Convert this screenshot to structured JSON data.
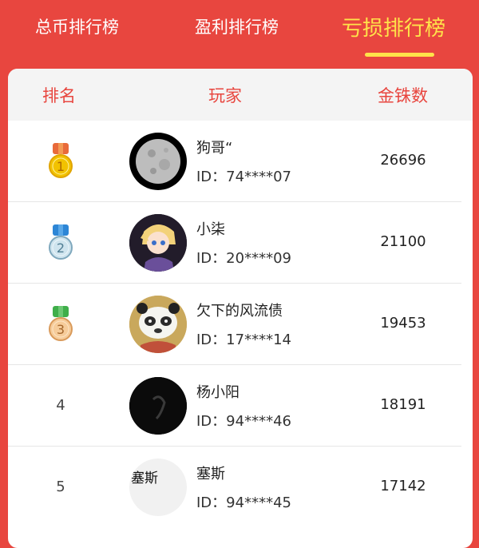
{
  "tabs": [
    {
      "label": "总币排行榜"
    },
    {
      "label": "盈利排行榜"
    },
    {
      "label": "亏损排行榜"
    }
  ],
  "table": {
    "headers": {
      "rank": "排名",
      "player": "玩家",
      "coins": "金铢数"
    },
    "rows": [
      {
        "rank": "1",
        "name": "狗哥“",
        "id": "ID：74****07",
        "coins": "26696"
      },
      {
        "rank": "2",
        "name": "小柒",
        "id": "ID：20****09",
        "coins": "21100"
      },
      {
        "rank": "3",
        "name": "欠下的风流债",
        "id": "ID：17****14",
        "coins": "19453"
      },
      {
        "rank": "4",
        "name": "杨小阳",
        "id": "ID：94****46",
        "coins": "18191"
      },
      {
        "rank": "5",
        "name": "塞斯",
        "id": "ID：94****45",
        "coins": "17142",
        "avatar_text": "塞斯"
      }
    ]
  },
  "colors": {
    "background": "#e8463f",
    "active_tab": "#ffe34a",
    "header_text": "#e8463f",
    "medal_gold": "#f2c200",
    "medal_silver": "#cfe4ee",
    "medal_bronze": "#f6cc9a"
  }
}
